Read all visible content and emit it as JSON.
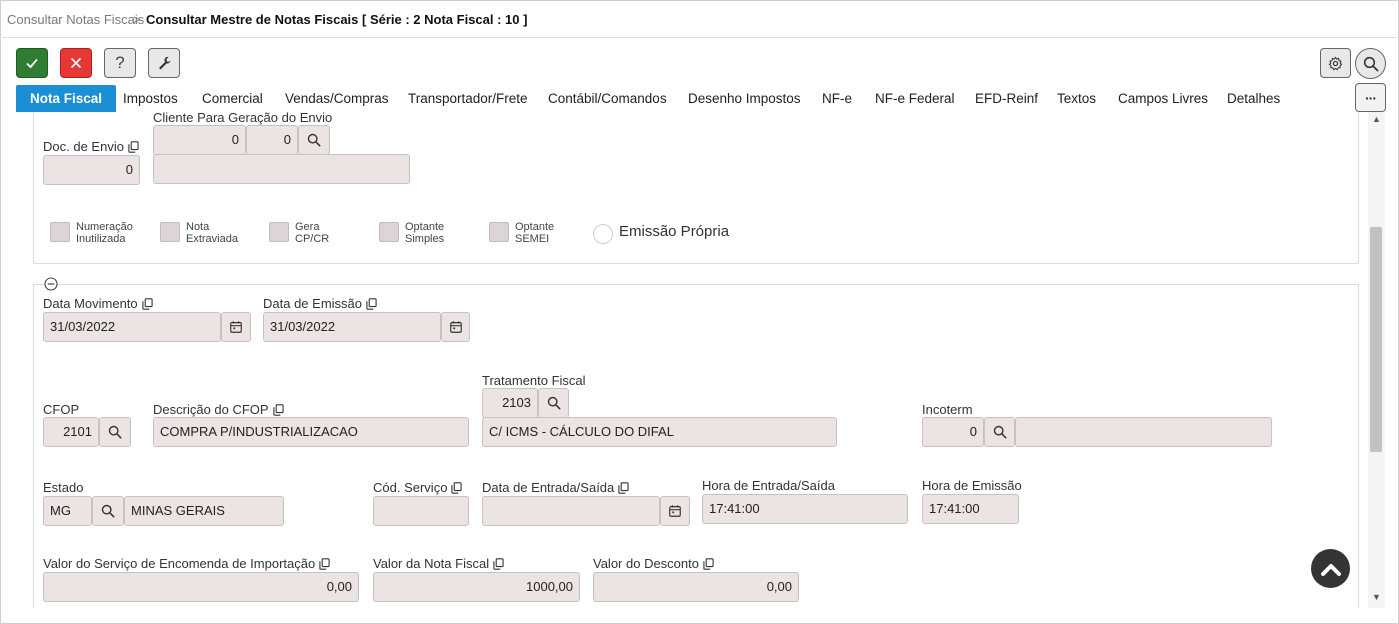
{
  "breadcrumb": {
    "parent": "Consultar Notas Fiscais",
    "separator": ">",
    "title": "Consultar Mestre de Notas Fiscais [ Série : 2 Nota Fiscal : 10 ]"
  },
  "toolbar": {
    "icons": [
      "check-icon",
      "close-icon",
      "help-icon",
      "wrench-icon",
      "gear-icon",
      "search-icon"
    ],
    "help_label": "?"
  },
  "tabs": [
    {
      "label": "Nota Fiscal",
      "active": true
    },
    {
      "label": "Impostos"
    },
    {
      "label": "Comercial"
    },
    {
      "label": "Vendas/Compras"
    },
    {
      "label": "Transportador/Frete"
    },
    {
      "label": "Contábil/Comandos"
    },
    {
      "label": "Desenho Impostos"
    },
    {
      "label": "NF-e"
    },
    {
      "label": "NF-e Federal"
    },
    {
      "label": "EFD-Reinf"
    },
    {
      "label": "Textos"
    },
    {
      "label": "Campos Livres"
    },
    {
      "label": "Detalhes"
    }
  ],
  "tabs_more_label": "···",
  "section1": {
    "doc_envio": {
      "label": "Doc. de Envio",
      "value": "0"
    },
    "cliente_envio": {
      "label": "Cliente Para Geração do Envio",
      "value1": "0",
      "value2": "0",
      "name": ""
    },
    "checkboxes": [
      {
        "line1": "Numeração",
        "line2": "Inutilizada"
      },
      {
        "line1": "Nota",
        "line2": "Extraviada"
      },
      {
        "line1": "Gera",
        "line2": "CP/CR"
      },
      {
        "line1": "Optante",
        "line2": "Simples"
      },
      {
        "line1": "Optante",
        "line2": "SEMEI"
      }
    ],
    "emissao_propria": "Emissão Própria"
  },
  "section2": {
    "data_movimento": {
      "label": "Data Movimento",
      "value": "31/03/2022"
    },
    "data_emissao": {
      "label": "Data de Emissão",
      "value": "31/03/2022"
    },
    "tratamento_fiscal": {
      "label": "Tratamento Fiscal",
      "code": "2103",
      "desc": "C/ ICMS - CÁLCULO DO DIFAL"
    },
    "cfop": {
      "label": "CFOP",
      "value": "2101"
    },
    "descricao_cfop": {
      "label": "Descrição do CFOP",
      "value": "COMPRA P/INDUSTRIALIZACAO"
    },
    "incoterm": {
      "label": "Incoterm",
      "value": "0",
      "desc": ""
    },
    "estado": {
      "label": "Estado",
      "code": "MG",
      "name": "MINAS GERAIS"
    },
    "cod_servico": {
      "label": "Cód. Serviço",
      "value": ""
    },
    "data_entrada_saida": {
      "label": "Data de Entrada/Saída",
      "value": ""
    },
    "hora_entrada_saida": {
      "label": "Hora de Entrada/Saída",
      "value": "17:41:00"
    },
    "hora_emissao": {
      "label": "Hora de Emissão",
      "value": "17:41:00"
    },
    "valor_servico_importacao": {
      "label": "Valor do Serviço de Encomenda de Importação",
      "value": "0,00"
    },
    "valor_nota_fiscal": {
      "label": "Valor da Nota Fiscal",
      "value": "1000,00"
    },
    "valor_desconto": {
      "label": "Valor do Desconto",
      "value": "0,00"
    }
  },
  "colors": {
    "accent": "#1a8fd6",
    "ok_button": "#2e7d32",
    "cancel_button": "#e53935",
    "field_bg": "#ece3e3"
  }
}
